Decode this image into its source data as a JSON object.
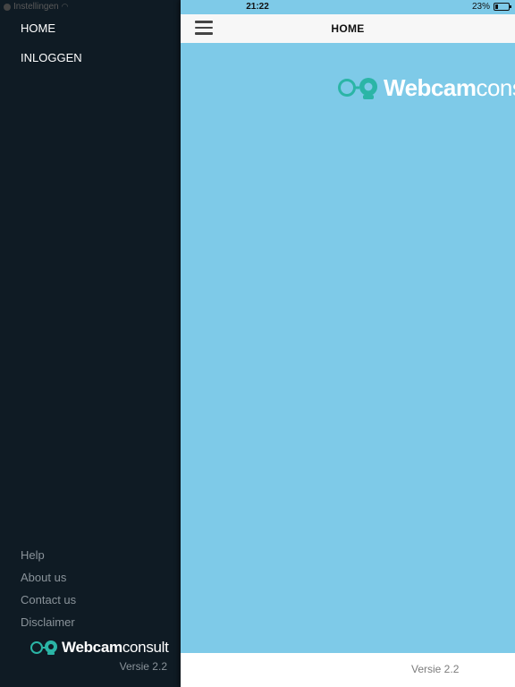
{
  "status_bar": {
    "carrier": "Instellingen",
    "time": "21:22",
    "battery_percent": "23%",
    "battery_level": 0.23
  },
  "sidebar": {
    "nav_items": [
      {
        "label": "HOME"
      },
      {
        "label": "INLOGGEN"
      }
    ],
    "footer_links": [
      {
        "label": "Help"
      },
      {
        "label": "About us"
      },
      {
        "label": "Contact us"
      },
      {
        "label": "Disclaimer"
      }
    ],
    "logo": {
      "strong": "Webcam",
      "light": "consult"
    },
    "version": "Versie 2.2"
  },
  "topbar": {
    "title": "HOME"
  },
  "hero": {
    "logo": {
      "strong": "Webcam",
      "light": "consult"
    }
  },
  "bottom": {
    "version": "Versie 2.2"
  },
  "colors": {
    "sidebar_bg": "#0f1b24",
    "hero_bg": "#7ecae8",
    "logo_teal": "#2bb5a6"
  }
}
